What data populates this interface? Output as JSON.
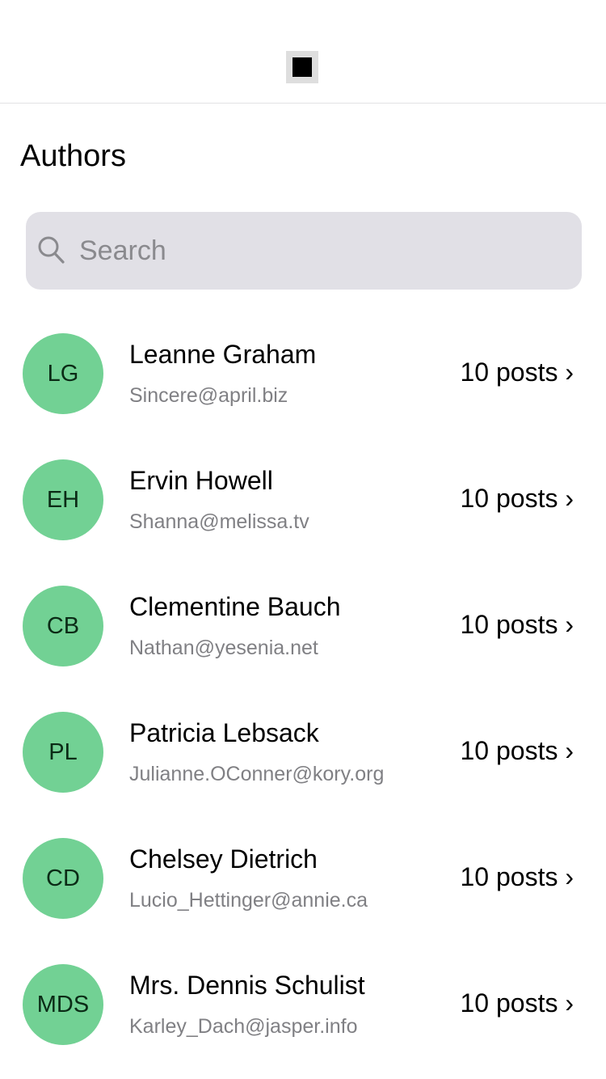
{
  "header": {
    "stop_icon": "stop-square-icon"
  },
  "page": {
    "title": "Authors"
  },
  "search": {
    "placeholder": "Search",
    "value": "",
    "icon": "search-icon"
  },
  "authors": [
    {
      "initials": "LG",
      "name": "Leanne Graham",
      "email": "Sincere@april.biz",
      "posts": "10 posts ›"
    },
    {
      "initials": "EH",
      "name": "Ervin Howell",
      "email": "Shanna@melissa.tv",
      "posts": "10 posts ›"
    },
    {
      "initials": "CB",
      "name": "Clementine Bauch",
      "email": "Nathan@yesenia.net",
      "posts": "10 posts ›"
    },
    {
      "initials": "PL",
      "name": "Patricia Lebsack",
      "email": "Julianne.OConner@kory.org",
      "posts": "10 posts ›"
    },
    {
      "initials": "CD",
      "name": "Chelsey Dietrich",
      "email": "Lucio_Hettinger@annie.ca",
      "posts": "10 posts ›"
    },
    {
      "initials": "MDS",
      "name": "Mrs. Dennis Schulist",
      "email": "Karley_Dach@jasper.info",
      "posts": "10 posts ›"
    }
  ],
  "colors": {
    "avatar_bg": "#72d194",
    "search_bg": "#e1e0e6",
    "secondary_text": "#808084"
  }
}
